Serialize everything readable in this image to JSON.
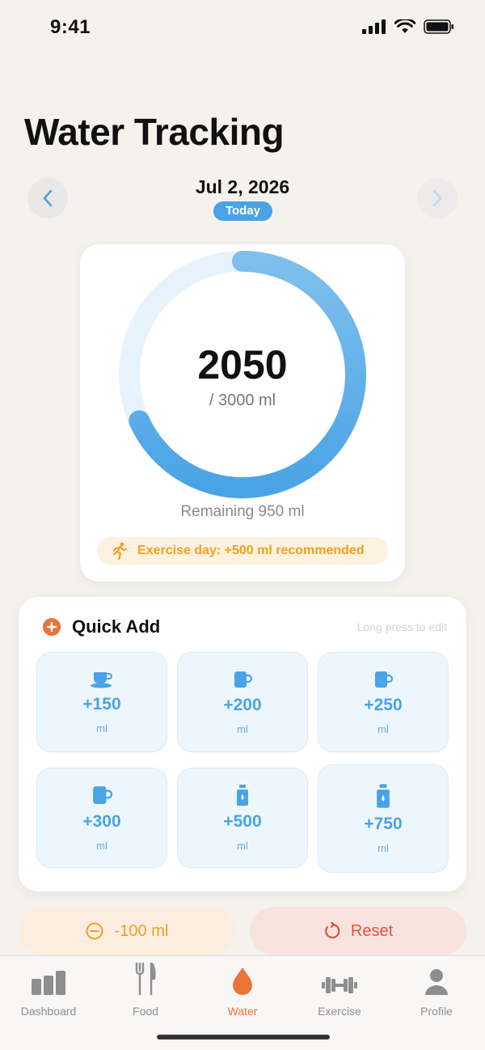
{
  "status": {
    "time": "9:41"
  },
  "header": {
    "title": "Water Tracking"
  },
  "date_nav": {
    "date": "Jul 2, 2026",
    "badge": "Today"
  },
  "progress": {
    "intake": "2050",
    "goal_text": "/ 3000 ml",
    "fraction": 0.683,
    "remaining": "Remaining 950 ml",
    "exercise_note": "Exercise day: +500 ml recommended"
  },
  "quick_add": {
    "title": "Quick Add",
    "hint": "Long press to edit",
    "items": [
      {
        "value": "+150",
        "unit": "ml",
        "icon": "coffee-cup-icon"
      },
      {
        "value": "+200",
        "unit": "ml",
        "icon": "mug-icon"
      },
      {
        "value": "+250",
        "unit": "ml",
        "icon": "mug-icon"
      },
      {
        "value": "+300",
        "unit": "ml",
        "icon": "mug-icon"
      },
      {
        "value": "+500",
        "unit": "ml",
        "icon": "bottle-icon"
      },
      {
        "value": "+750",
        "unit": "ml",
        "icon": "bottle-icon"
      }
    ]
  },
  "actions": {
    "minus": "-100 ml",
    "reset": "Reset"
  },
  "tabs": [
    {
      "label": "Dashboard",
      "icon": "bar-chart-icon"
    },
    {
      "label": "Food",
      "icon": "fork-knife-icon"
    },
    {
      "label": "Water",
      "icon": "water-drop-icon",
      "active": true
    },
    {
      "label": "Exercise",
      "icon": "dumbbell-icon"
    },
    {
      "label": "Profile",
      "icon": "person-icon"
    }
  ],
  "colors": {
    "accent_blue": "#4aa3e6",
    "accent_orange": "#e8743a",
    "warning": "#f0a020",
    "danger": "#e0533a"
  }
}
